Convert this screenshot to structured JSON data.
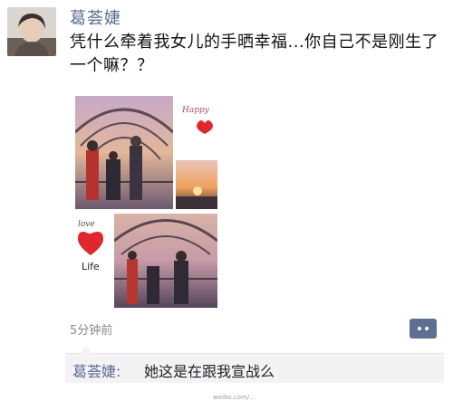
{
  "post": {
    "author": "葛荟婕",
    "text": "凭什么牵着我女儿的手晒幸福...你自己不是刚生了一个嘛？？",
    "time": "5分钟前"
  },
  "photo_grid": {
    "happy_label": "Happy",
    "love_label": "love",
    "life_label": "Life",
    "watermark": "weibo.com/..."
  },
  "comment": {
    "author": "葛荟婕:",
    "text": "她这是在跟我宣战么"
  },
  "colors": {
    "name_blue": "#5b6b92",
    "comment_button": "#5f6f93",
    "heart_red": "#e0262f"
  }
}
